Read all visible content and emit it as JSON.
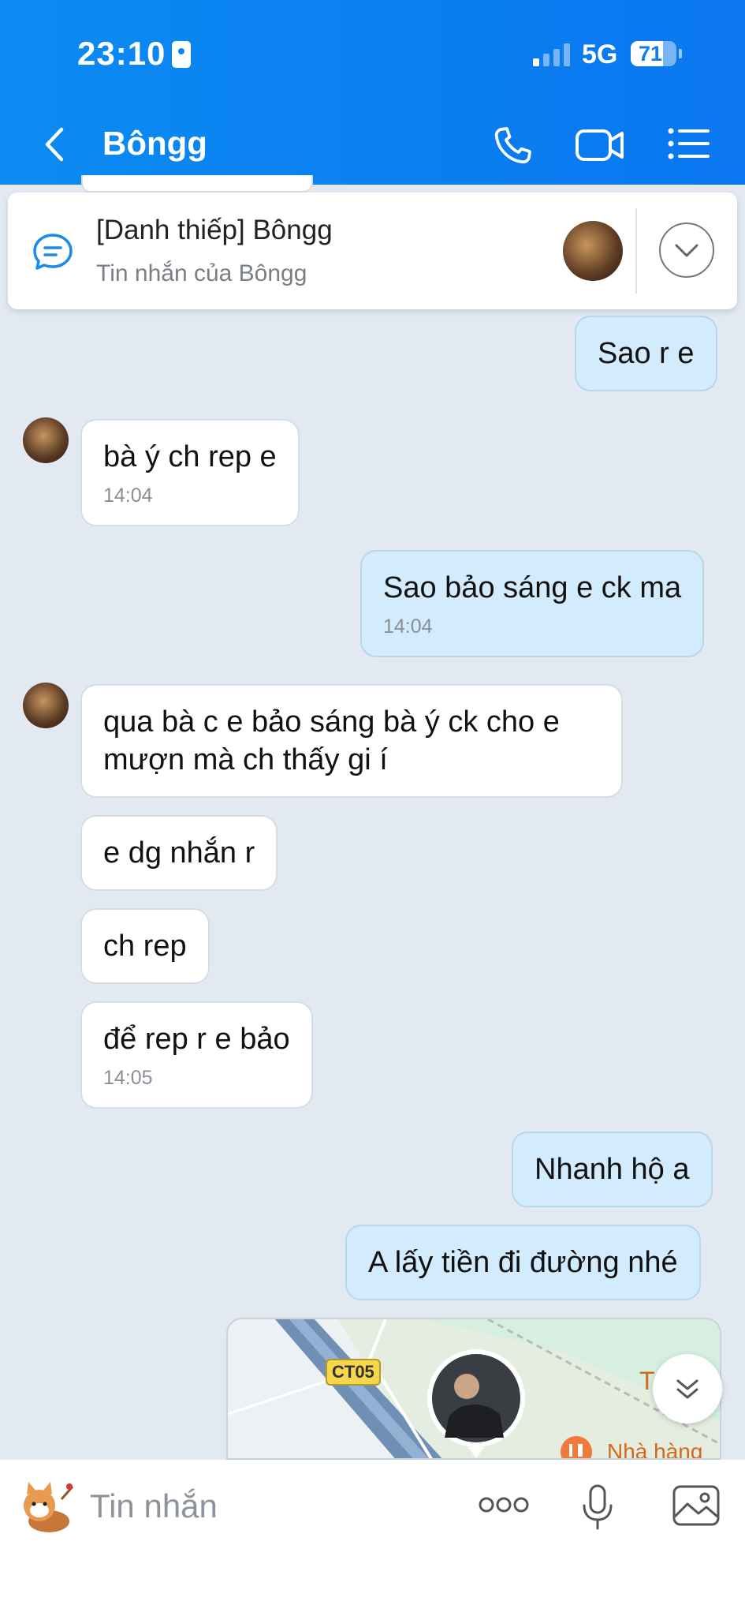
{
  "status_bar": {
    "time": "23:10",
    "network": "5G",
    "battery": "71",
    "battery_level": 0.71
  },
  "header": {
    "contact_name": "Bôngg"
  },
  "pinned": {
    "title": "[Danh thiếp] Bôngg",
    "subtitle": "Tin nhắn của Bôngg"
  },
  "messages": [
    {
      "dir": "out",
      "text": "Sao r e",
      "time": ""
    },
    {
      "dir": "in",
      "text": "bà ý ch rep e",
      "time": "14:04"
    },
    {
      "dir": "out",
      "text": "Sao bảo sáng e ck ma",
      "time": "14:04"
    },
    {
      "dir": "in",
      "text": "qua bà c e bảo sáng bà ý ck cho e mượn mà ch thấy gi í",
      "time": ""
    },
    {
      "dir": "in",
      "text": "e dg nhắn r",
      "time": ""
    },
    {
      "dir": "in",
      "text": "ch rep",
      "time": ""
    },
    {
      "dir": "in",
      "text": "để rep r e bảo",
      "time": "14:05"
    },
    {
      "dir": "out",
      "text": "Nhanh hộ a",
      "time": ""
    },
    {
      "dir": "out",
      "text": "A lấy tiền đi đường nhé",
      "time": ""
    }
  ],
  "map": {
    "road_label": "CT05",
    "place_label": "Nhà hàng",
    "place_initial": "T"
  },
  "input": {
    "placeholder": "Tin nhắn"
  },
  "colors": {
    "header_blue": "#0b84f1",
    "outgoing_bubble": "#d3ecfd",
    "incoming_bubble": "#ffffff",
    "chat_background": "#e2e9f1"
  },
  "icons": [
    "back-icon",
    "phone-icon",
    "video-call-icon",
    "list-menu-icon",
    "chat-bubble-icon",
    "chevron-down-icon",
    "double-chevron-down-icon",
    "sticker-icon",
    "more-dots-icon",
    "microphone-icon",
    "image-icon"
  ]
}
